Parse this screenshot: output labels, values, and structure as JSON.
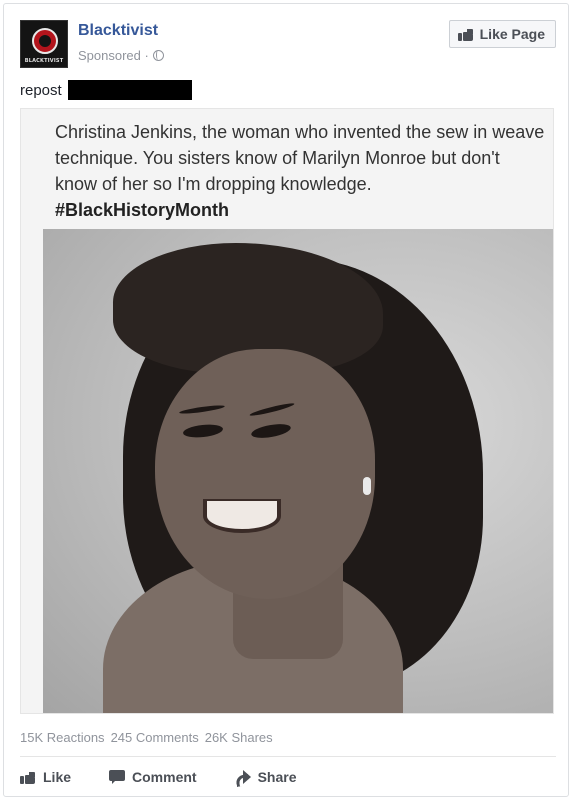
{
  "post": {
    "page_name": "Blacktivist",
    "sponsored_label": "Sponsored · ",
    "avatar_text": "BLACKTIVIST",
    "caption": "repost",
    "like_page_label": "Like Page"
  },
  "image": {
    "quote": "Christina Jenkins, the woman who invented the sew in weave technique. You sisters know of Marilyn Monroe but don't know of her so I'm dropping knowledge.",
    "hashtag": "#BlackHistoryMonth"
  },
  "stats": {
    "reactions": "15K Reactions",
    "comments": "245 Comments",
    "shares": "26K Shares"
  },
  "actions": {
    "like": "Like",
    "comment": "Comment",
    "share": "Share"
  },
  "icons": {
    "like_page": "thumbs-up-icon",
    "privacy": "globe-icon",
    "like": "thumbs-up-icon",
    "comment": "comment-icon",
    "share": "share-arrow-icon"
  },
  "colors": {
    "page_name": "#365899",
    "meta_text": "#90949c",
    "action_text": "#4b4f56"
  }
}
